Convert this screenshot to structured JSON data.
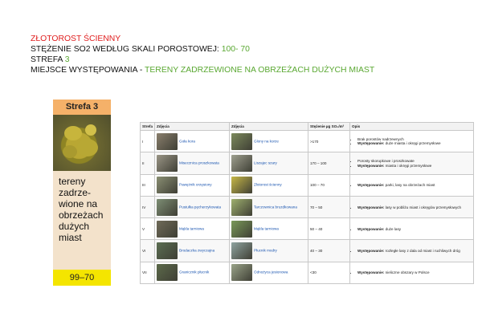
{
  "header": {
    "line1": "ZŁOTOROST ŚCIENNY",
    "line2_label": "STĘŻENIE SO2 WEDŁUG SKALI POROSTOWEJ: ",
    "line2_value": "100- 70",
    "line3_label": "STREFA ",
    "line3_value": "3",
    "line4_label": "MIEJSCE WYSTĘPOWANIA - ",
    "line4_value": "TERENY ZADRZEWIONE NA OBRZEŻACH DUŻYCH MIAST"
  },
  "card": {
    "title": "Strefa 3",
    "text_lines": [
      "tereny",
      "zadrze-",
      "wione na",
      "obrzeżach",
      "dużych",
      "miast"
    ],
    "range": "99–70"
  },
  "table": {
    "headers": [
      "Strefa",
      "Zdjęcia",
      "Zdjęcia",
      "Stężenie µg SO₂/m³",
      "Opis"
    ],
    "rows": [
      {
        "zone": "I",
        "a": "Goła kora",
        "b": "Glony na korze",
        "conc": ">170",
        "notes": [
          {
            "bold": "",
            "text": "Brak porostów nadrzewnych"
          },
          {
            "bold": "Występowanie:",
            "text": " duże miasta i okręgi przemysłowe"
          }
        ]
      },
      {
        "zone": "II",
        "a": "Misecznica proszkowata",
        "b": "Liszajec szary",
        "conc": "170 – 100",
        "notes": [
          {
            "bold": "",
            "text": "Porosty skorupkowe i proszkowate"
          },
          {
            "bold": "Występowanie:",
            "text": " miasta i okręgi przemysłowe"
          }
        ]
      },
      {
        "zone": "III",
        "a": "Pawężnik orzęsiony",
        "b": "Złotorost ścienny",
        "conc": "100 – 70",
        "notes": [
          {
            "bold": "Występowanie:",
            "text": " parki, lasy na obrzeżach miast"
          }
        ]
      },
      {
        "zone": "IV",
        "a": "Pustułka pęcherzykowata",
        "b": "Tarczownica bruzdkowana",
        "conc": "70 – 50",
        "notes": [
          {
            "bold": "Występowanie:",
            "text": " lasy w pobliżu miast i okręgów przemysłowych"
          }
        ]
      },
      {
        "zone": "V",
        "a": "Mąkla tarniowa",
        "b": "Mąkla tarniowa",
        "conc": "50 – 40",
        "notes": [
          {
            "bold": "Występowanie:",
            "text": " duże lasy"
          }
        ]
      },
      {
        "zone": "VI",
        "a": "Brodaczka zwyczajna",
        "b": "Płucnik modry",
        "conc": "40 – 30",
        "notes": [
          {
            "bold": "Występowanie:",
            "text": " rozległe lasy z dala od miast i ruchliwych dróg"
          }
        ]
      },
      {
        "zone": "VII",
        "a": "Granicznik płucnik",
        "b": "Odnożyca jesionowa",
        "conc": "<30",
        "notes": [
          {
            "bold": "Występowanie:",
            "text": " nieliczne obszary w Polsce"
          }
        ]
      }
    ]
  },
  "thumb_colors": [
    [
      "#8a7f6d",
      "#7c8a5c"
    ],
    [
      "#9a9586",
      "#9ea08f"
    ],
    [
      "#8a8f73",
      "#c7b847"
    ],
    [
      "#7d8e74",
      "#9fb06e"
    ],
    [
      "#6f6a58",
      "#7a9a58"
    ],
    [
      "#5b6e52",
      "#8fa4a0"
    ],
    [
      "#5c6a4a",
      "#9aa489"
    ]
  ]
}
